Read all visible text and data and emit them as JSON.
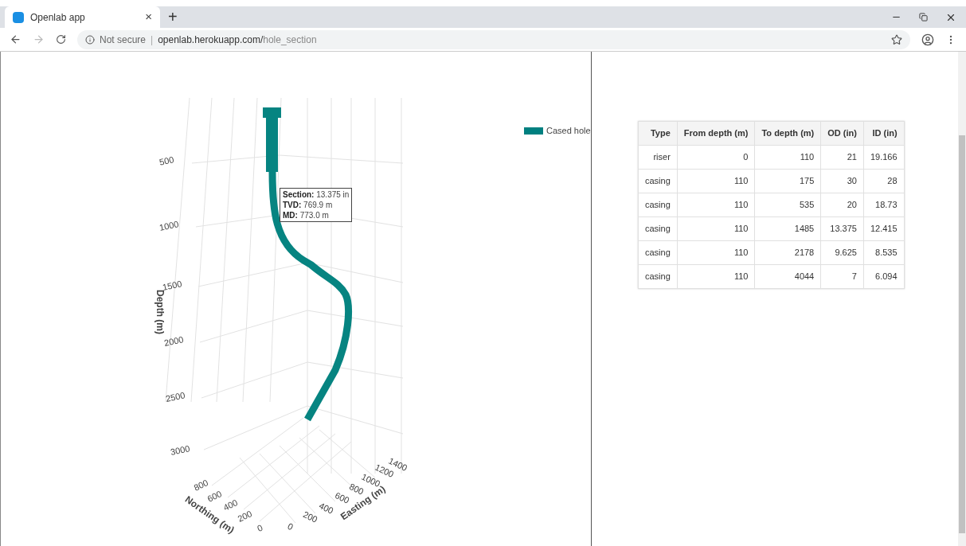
{
  "browser": {
    "tab": {
      "title": "Openlab app",
      "close": "×",
      "selected": true
    },
    "new_tab": "+",
    "security": "Not secure",
    "separator": "|",
    "url_host": "openlab.herokuapp.com/",
    "url_path": "hole_section"
  },
  "plot": {
    "depth_axis": {
      "title": "Depth (m)",
      "ticks": [
        "500",
        "1000",
        "1500",
        "2000",
        "2500",
        "3000"
      ]
    },
    "northing_axis": {
      "title": "Northing (m)",
      "ticks": [
        "800",
        "600",
        "400",
        "200",
        "0"
      ]
    },
    "easting_axis": {
      "title": "Easting (m)",
      "ticks": [
        "1400",
        "1200",
        "1000",
        "800",
        "600",
        "400",
        "200",
        "0"
      ]
    },
    "legend": {
      "label": "Cased hole",
      "color": "#008080"
    },
    "tooltip": [
      {
        "key": "Section:",
        "value": " 13.375 in"
      },
      {
        "key": "TVD:",
        "value": " 769.9 m"
      },
      {
        "key": "MD:",
        "value": " 773.0 m"
      }
    ]
  },
  "table": {
    "columns": [
      "Type",
      "From depth (m)",
      "To depth (m)",
      "OD (in)",
      "ID (in)"
    ],
    "rows": [
      [
        "riser",
        "0",
        "110",
        "21",
        "19.166"
      ],
      [
        "casing",
        "110",
        "175",
        "30",
        "28"
      ],
      [
        "casing",
        "110",
        "535",
        "20",
        "18.73"
      ],
      [
        "casing",
        "110",
        "1485",
        "13.375",
        "12.415"
      ],
      [
        "casing",
        "110",
        "2178",
        "9.625",
        "8.535"
      ],
      [
        "casing",
        "110",
        "4044",
        "7",
        "6.094"
      ]
    ]
  }
}
